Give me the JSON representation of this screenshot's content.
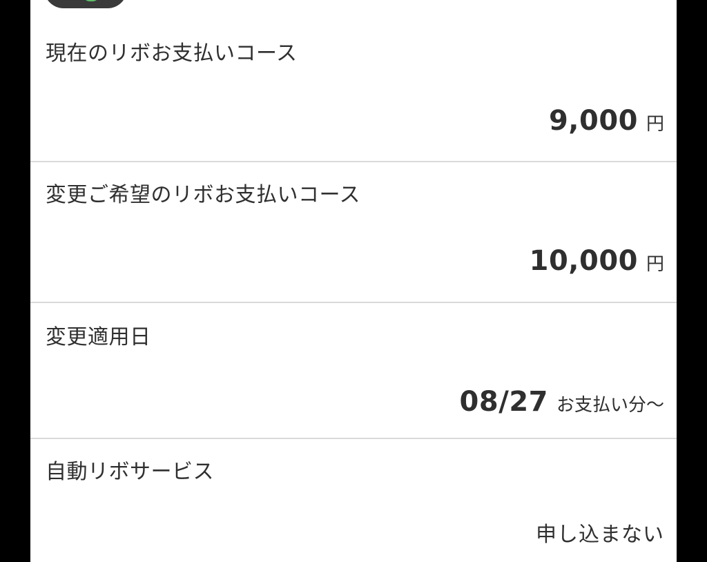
{
  "rows": [
    {
      "label": "現在のリボお支払いコース",
      "value": "9,000",
      "unit": "円"
    },
    {
      "label": "変更ご希望のリボお支払いコース",
      "value": "10,000",
      "unit": "円"
    },
    {
      "label": "変更適用日",
      "value": "08/27",
      "unit": "お支払い分〜"
    },
    {
      "label": "自動リボサービス",
      "value": "申し込まない"
    }
  ],
  "colors": {
    "background": "#ffffff",
    "text": "#2f2f2f",
    "divider": "#d9d9d9",
    "frame": "#000000"
  }
}
